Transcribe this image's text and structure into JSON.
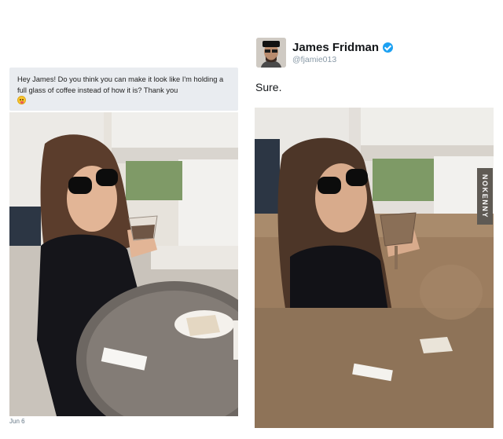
{
  "request": {
    "text": "Hey James! Do you think you can make it look like I'm holding a full glass of coffee instead of how it is? Thank you",
    "emoji": "tongue-smiley-emoji"
  },
  "profile": {
    "name": "James Fridman",
    "handle": "@fjamie013",
    "verified": true
  },
  "reply": {
    "text": "Sure."
  },
  "date": "Jun 6",
  "watermark": "NOKENNY",
  "colors": {
    "verified": "#1da1f2",
    "card_bg": "#e9ecf0",
    "coffee": "#8a6f57"
  }
}
